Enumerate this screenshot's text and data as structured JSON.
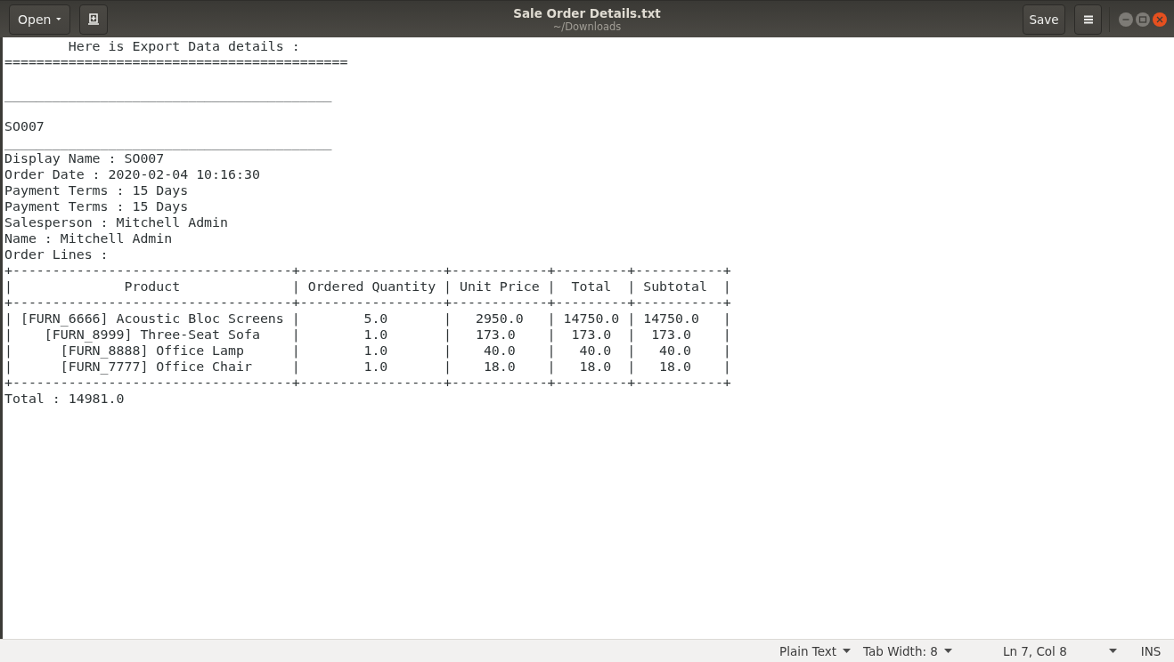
{
  "window": {
    "title": "Sale Order Details.txt",
    "subtitle": "~/Downloads"
  },
  "header_bar": {
    "open_button": "Open",
    "save_button": "Save"
  },
  "document": {
    "blocks": [
      [
        "        Here is Export Data details :",
        "==========================================="
      ],
      [
        "_________________________________________"
      ],
      [
        "SO007",
        "_________________________________________",
        "Display Name : SO007",
        "Order Date : 2020-02-04 10:16:30",
        "Payment Terms : 15 Days",
        "Payment Terms : 15 Days",
        "Salesperson : Mitchell Admin",
        "Name : Mitchell Admin",
        "Order Lines :",
        "+-----------------------------------+------------------+------------+---------+-----------+",
        "|              Product              | Ordered Quantity | Unit Price |  Total  | Subtotal  |",
        "+-----------------------------------+------------------+------------+---------+-----------+",
        "| [FURN_6666] Acoustic Bloc Screens |        5.0       |   2950.0   | 14750.0 | 14750.0   |",
        "|    [FURN_8999] Three-Seat Sofa    |        1.0       |   173.0    |  173.0  |  173.0    |",
        "|      [FURN_8888] Office Lamp      |        1.0       |    40.0    |   40.0  |   40.0    |",
        "|      [FURN_7777] Office Chair     |        1.0       |    18.0    |   18.0  |   18.0    |",
        "+-----------------------------------+------------------+------------+---------+-----------+",
        "Total : 14981.0"
      ]
    ]
  },
  "status_bar": {
    "language": "Plain Text",
    "tab_width": "Tab Width: 8",
    "position": "Ln 7, Col 8",
    "mode": "INS"
  }
}
